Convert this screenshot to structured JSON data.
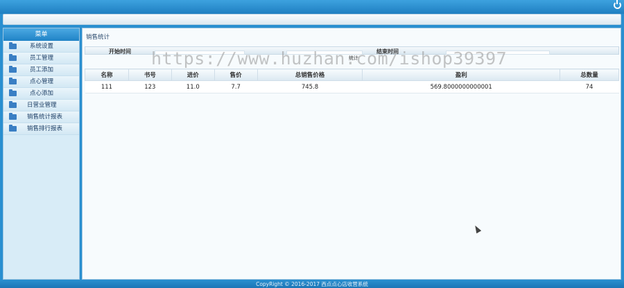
{
  "sidebar": {
    "title": "菜单",
    "items": [
      {
        "label": "系统设置"
      },
      {
        "label": "员工管理"
      },
      {
        "label": "员工添加"
      },
      {
        "label": "点心管理"
      },
      {
        "label": "点心添加"
      },
      {
        "label": "日营业管理"
      },
      {
        "label": "销售统计报表"
      },
      {
        "label": "销售排行报表"
      }
    ]
  },
  "content": {
    "breadcrumb": "销售统计",
    "filters": {
      "start_label": "开始时间",
      "end_label": "结束时间",
      "submit_label": "统计"
    },
    "table": {
      "headers": [
        "名称",
        "书号",
        "进价",
        "售价",
        "总销售价格",
        "盈利",
        "总数量"
      ],
      "rows": [
        [
          "111",
          "123",
          "11.0",
          "7.7",
          "745.8",
          "569.8000000000001",
          "74"
        ]
      ]
    }
  },
  "footer": {
    "copyright": "CopyRight © 2016-2017 西点点心店收营系统"
  },
  "watermark": "https://www.huzhan.com/ishop39397",
  "colors": {
    "brand": "#2a8fd0",
    "sidebar_bg": "#d8ecf7",
    "content_bg": "#f7fbfd"
  }
}
